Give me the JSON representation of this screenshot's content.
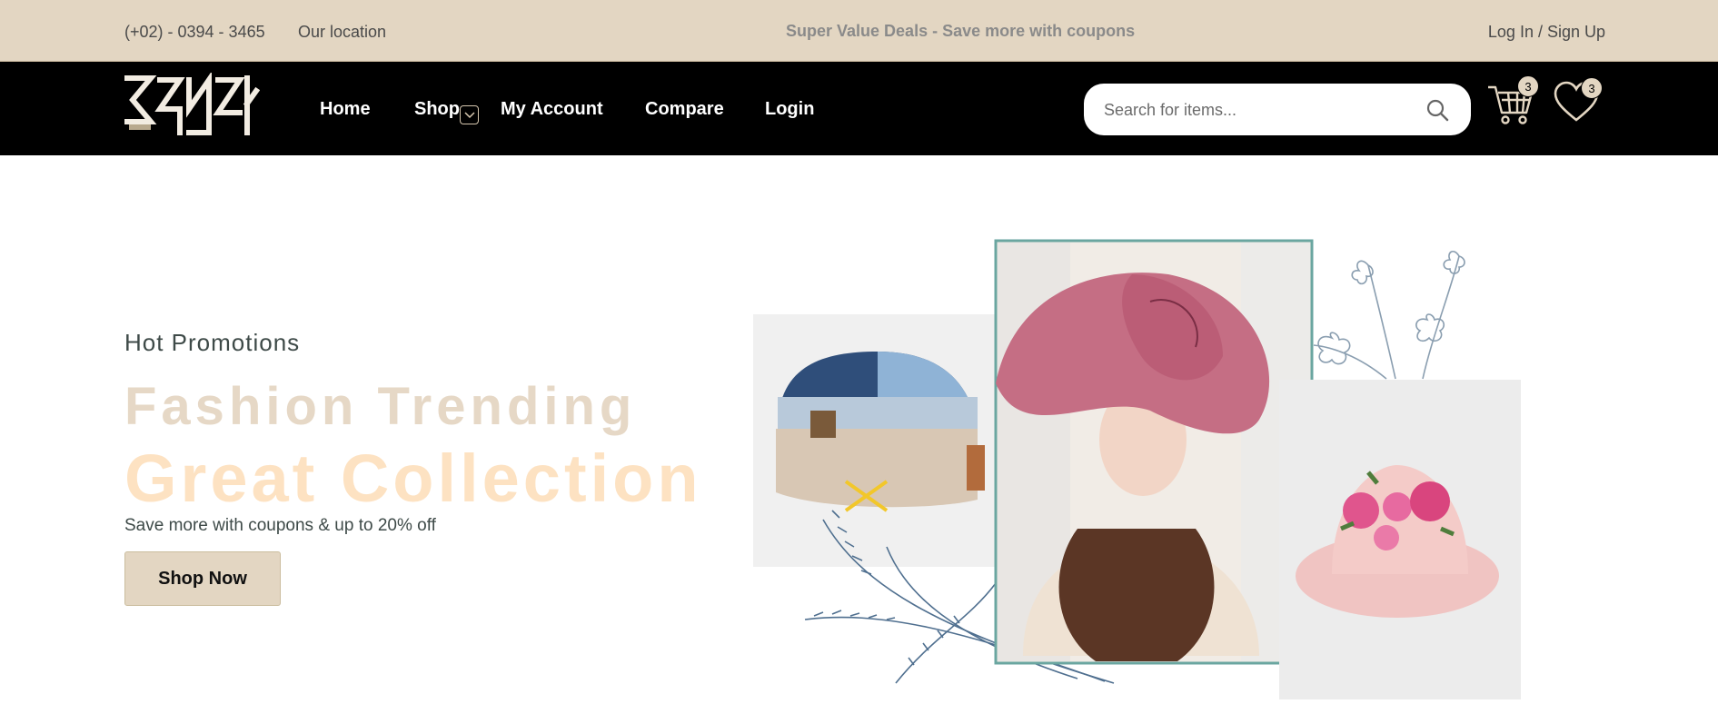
{
  "topbar": {
    "phone": "(+02) - 0394 - 3465",
    "location": "Our location",
    "deal": "Super Value Deals - Save more with coupons",
    "auth": "Log In / Sign Up"
  },
  "navbar": {
    "logo_icon": "brand-logo",
    "links": [
      "Home",
      "Shop",
      "My Account",
      "Compare",
      "Login"
    ],
    "shop_dropdown_icon": "chevron-down-icon",
    "search": {
      "placeholder": "Search for items...",
      "value": "",
      "icon": "search-icon"
    },
    "cart": {
      "icon": "cart-icon",
      "count": "3"
    },
    "wishlist": {
      "icon": "heart-icon",
      "count": "3"
    }
  },
  "hero": {
    "subtitle": "Hot Promotions",
    "title_line1": "Fashion Trending",
    "title_line2": "Great Collection",
    "description": "Save more with coupons & up to 20% off",
    "button": "Shop Now",
    "images": [
      "denim-cap-image",
      "pink-hat-woman-image",
      "floral-pink-hat-image",
      "flower-sketch",
      "wheat-sketch"
    ]
  },
  "colors": {
    "topbar_bg": "#e3d6c2",
    "navbar_bg": "#000000",
    "title_line1": "#e6d8c6",
    "title_line2": "#fde2c2",
    "image_border": "#6aa6a0"
  }
}
